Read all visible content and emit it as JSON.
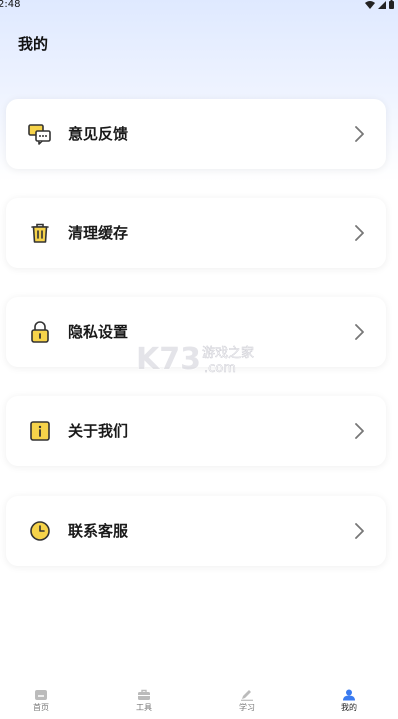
{
  "status_bar": {
    "time": "2:48"
  },
  "page": {
    "title": "我的"
  },
  "menu": [
    {
      "label": "意见反馈",
      "icon": "feedback-chat-icon"
    },
    {
      "label": "清理缓存",
      "icon": "trash-icon"
    },
    {
      "label": "隐私设置",
      "icon": "lock-icon"
    },
    {
      "label": "关于我们",
      "icon": "info-icon"
    },
    {
      "label": "联系客服",
      "icon": "clock-icon"
    }
  ],
  "watermark": {
    "main": "K73",
    "sub1": "游戏之家",
    "sub2": ".com"
  },
  "tabbar": [
    {
      "label": "首页",
      "icon": "home-icon"
    },
    {
      "label": "工具",
      "icon": "toolbox-icon"
    },
    {
      "label": "学习",
      "icon": "pen-icon"
    },
    {
      "label": "我的",
      "icon": "profile-icon",
      "active": true
    }
  ],
  "colors": {
    "accent": "#3a7bf0",
    "icon_yellow": "#f6d34a",
    "icon_stroke": "#333333"
  }
}
